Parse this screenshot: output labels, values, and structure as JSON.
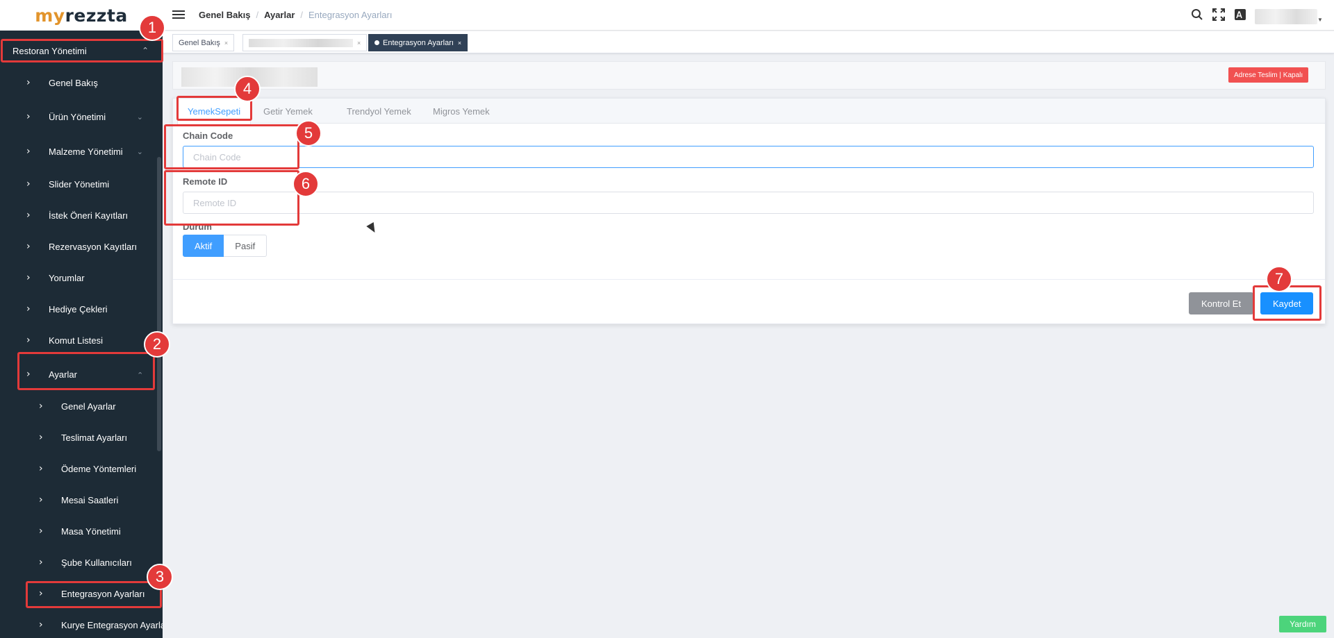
{
  "app": {
    "logo_prefix": "my",
    "logo_suffix": "rezzta"
  },
  "sidebar": {
    "root": {
      "label": "Restoran Yönetimi"
    },
    "items": [
      {
        "label": "Genel Bakış"
      },
      {
        "label": "Ürün Yönetimi"
      },
      {
        "label": "Malzeme Yönetimi"
      },
      {
        "label": "Slider Yönetimi"
      },
      {
        "label": "İstek Öneri Kayıtları"
      },
      {
        "label": "Rezervasyon Kayıtları"
      },
      {
        "label": "Yorumlar"
      },
      {
        "label": "Hediye Çekleri"
      },
      {
        "label": "Komut Listesi"
      },
      {
        "label": "Ayarlar"
      }
    ],
    "subitems": [
      {
        "label": "Genel Ayarlar"
      },
      {
        "label": "Teslimat Ayarları"
      },
      {
        "label": "Ödeme Yöntemleri"
      },
      {
        "label": "Mesai Saatleri"
      },
      {
        "label": "Masa Yönetimi"
      },
      {
        "label": "Şube Kullanıcıları"
      },
      {
        "label": "Entegrasyon Ayarları"
      },
      {
        "label": "Kurye Entegrasyon Ayarları"
      }
    ]
  },
  "breadcrumb": [
    "Genel Bakış",
    "Ayarlar",
    "Entegrasyon Ayarları"
  ],
  "breadcrumb_sep": "/",
  "tags": {
    "first": "Genel Bakış",
    "active": "Entegrasyon Ayarları",
    "close": "×"
  },
  "status_badge": "Adrese Teslim | Kapalı",
  "tabs": [
    "YemekSepeti",
    "Getir Yemek",
    "Trendyol Yemek",
    "Migros Yemek"
  ],
  "form": {
    "chain_code": {
      "label": "Chain Code",
      "placeholder": "Chain Code",
      "value": ""
    },
    "remote_id": {
      "label": "Remote ID",
      "placeholder": "Remote ID",
      "value": ""
    },
    "status": {
      "label": "Durum",
      "options": [
        "Aktif",
        "Pasif"
      ],
      "selected": "Aktif"
    }
  },
  "actions": {
    "check": "Kontrol Et",
    "save": "Kaydet"
  },
  "help": "Yardım",
  "annotations": [
    "1",
    "2",
    "3",
    "4",
    "5",
    "6",
    "7"
  ],
  "colors": {
    "sidebar_bg": "#1d2b36",
    "primary": "#1890ff",
    "annotation": "#e33a3a",
    "danger": "#f15151",
    "help": "#4cd47b"
  }
}
